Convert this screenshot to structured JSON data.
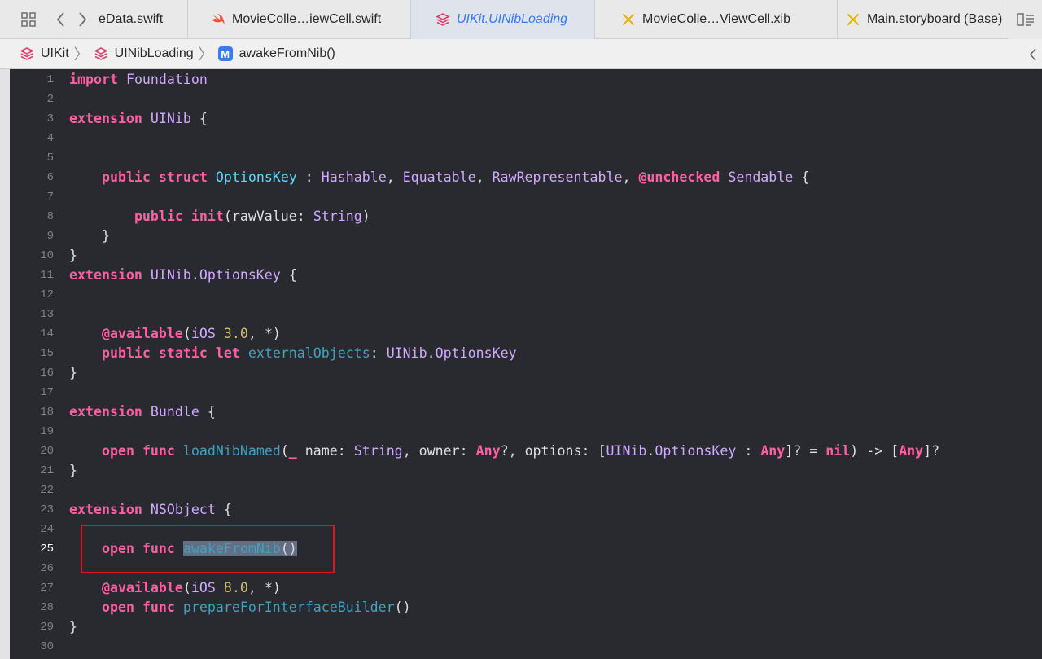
{
  "tabbar": {
    "tabs": [
      {
        "label": "eData.swift",
        "icon": "swift-file-icon"
      },
      {
        "label": "MovieColle…iewCell.swift",
        "icon": "swift-file-icon"
      },
      {
        "label": "UIKit.UINibLoading",
        "icon": "module-stack-icon",
        "active": true
      },
      {
        "label": "MovieColle…ViewCell.xib",
        "icon": "interface-builder-icon"
      },
      {
        "label": "Main.storyboard (Base)",
        "icon": "interface-builder-icon"
      }
    ]
  },
  "jumpbar": {
    "crumbs": [
      "UIKit",
      "UINibLoading",
      "awakeFromNib()"
    ],
    "method_badge": "M"
  },
  "colors": {
    "keyword": "#fc5fa3",
    "type": "#d0a8ff",
    "declaration": "#5dd8ff",
    "function_ref": "#41a1c0",
    "number": "#d0bf69",
    "plain": "#dfdfe0",
    "background": "#292a30",
    "highlight_box": "#e0141e"
  },
  "editor": {
    "current_line": 25,
    "lines": [
      {
        "n": "1",
        "t": [
          [
            "kw",
            "import"
          ],
          [
            "pl",
            " "
          ],
          [
            "ty",
            "Foundation"
          ]
        ]
      },
      {
        "n": "2",
        "t": []
      },
      {
        "n": "3",
        "t": [
          [
            "kw",
            "extension"
          ],
          [
            "pl",
            " "
          ],
          [
            "ty",
            "UINib"
          ],
          [
            "pl",
            " {"
          ]
        ]
      },
      {
        "n": "4",
        "t": []
      },
      {
        "n": "5",
        "t": []
      },
      {
        "n": "6",
        "t": [
          [
            "pl",
            "    "
          ],
          [
            "kw",
            "public"
          ],
          [
            "pl",
            " "
          ],
          [
            "kw",
            "struct"
          ],
          [
            "pl",
            " "
          ],
          [
            "decl",
            "OptionsKey"
          ],
          [
            "pl",
            " : "
          ],
          [
            "ty",
            "Hashable"
          ],
          [
            "pl",
            ", "
          ],
          [
            "ty",
            "Equatable"
          ],
          [
            "pl",
            ", "
          ],
          [
            "ty",
            "RawRepresentable"
          ],
          [
            "pl",
            ", "
          ],
          [
            "kw",
            "@unchecked"
          ],
          [
            "pl",
            " "
          ],
          [
            "ty",
            "Sendable"
          ],
          [
            "pl",
            " {"
          ]
        ]
      },
      {
        "n": "7",
        "t": []
      },
      {
        "n": "8",
        "t": [
          [
            "pl",
            "        "
          ],
          [
            "kw",
            "public"
          ],
          [
            "pl",
            " "
          ],
          [
            "kw",
            "init"
          ],
          [
            "pl",
            "(rawValue: "
          ],
          [
            "ty",
            "String"
          ],
          [
            "pl",
            ")"
          ]
        ]
      },
      {
        "n": "9",
        "t": [
          [
            "pl",
            "    }"
          ]
        ]
      },
      {
        "n": "10",
        "t": [
          [
            "pl",
            "}"
          ]
        ]
      },
      {
        "n": "11",
        "t": [
          [
            "kw",
            "extension"
          ],
          [
            "pl",
            " "
          ],
          [
            "ty",
            "UINib"
          ],
          [
            "pl",
            "."
          ],
          [
            "ty",
            "OptionsKey"
          ],
          [
            "pl",
            " {"
          ]
        ]
      },
      {
        "n": "12",
        "t": []
      },
      {
        "n": "13",
        "t": []
      },
      {
        "n": "14",
        "t": [
          [
            "pl",
            "    "
          ],
          [
            "kw",
            "@available"
          ],
          [
            "pl",
            "("
          ],
          [
            "ty",
            "iOS"
          ],
          [
            "pl",
            " "
          ],
          [
            "num",
            "3.0"
          ],
          [
            "pl",
            ", *)"
          ]
        ]
      },
      {
        "n": "15",
        "t": [
          [
            "pl",
            "    "
          ],
          [
            "kw",
            "public"
          ],
          [
            "pl",
            " "
          ],
          [
            "kw",
            "static"
          ],
          [
            "pl",
            " "
          ],
          [
            "kw",
            "let"
          ],
          [
            "pl",
            " "
          ],
          [
            "fn",
            "externalObjects"
          ],
          [
            "pl",
            ": "
          ],
          [
            "ty",
            "UINib"
          ],
          [
            "pl",
            "."
          ],
          [
            "ty",
            "OptionsKey"
          ]
        ]
      },
      {
        "n": "16",
        "t": [
          [
            "pl",
            "}"
          ]
        ]
      },
      {
        "n": "17",
        "t": []
      },
      {
        "n": "18",
        "t": [
          [
            "kw",
            "extension"
          ],
          [
            "pl",
            " "
          ],
          [
            "ty",
            "Bundle"
          ],
          [
            "pl",
            " {"
          ]
        ]
      },
      {
        "n": "19",
        "t": []
      },
      {
        "n": "20",
        "t": [
          [
            "pl",
            "    "
          ],
          [
            "kw",
            "open"
          ],
          [
            "pl",
            " "
          ],
          [
            "kw",
            "func"
          ],
          [
            "pl",
            " "
          ],
          [
            "fn",
            "loadNibNamed"
          ],
          [
            "pl",
            "("
          ],
          [
            "kw",
            "_"
          ],
          [
            "pl",
            " name: "
          ],
          [
            "ty",
            "String"
          ],
          [
            "pl",
            ", owner: "
          ],
          [
            "kw",
            "Any"
          ],
          [
            "pl",
            "?, options: ["
          ],
          [
            "ty",
            "UINib"
          ],
          [
            "pl",
            "."
          ],
          [
            "ty",
            "OptionsKey"
          ],
          [
            "pl",
            " : "
          ],
          [
            "kw",
            "Any"
          ],
          [
            "pl",
            "]? = "
          ],
          [
            "kw",
            "nil"
          ],
          [
            "pl",
            ") -> ["
          ],
          [
            "kw",
            "Any"
          ],
          [
            "pl",
            "]?"
          ]
        ]
      },
      {
        "n": "21",
        "t": [
          [
            "pl",
            "}"
          ]
        ]
      },
      {
        "n": "22",
        "t": []
      },
      {
        "n": "23",
        "t": [
          [
            "kw",
            "extension"
          ],
          [
            "pl",
            " "
          ],
          [
            "ty",
            "NSObject"
          ],
          [
            "pl",
            " {"
          ]
        ]
      },
      {
        "n": "24",
        "t": []
      },
      {
        "n": "25",
        "t": [
          [
            "pl",
            "    "
          ],
          [
            "kw",
            "open"
          ],
          [
            "pl",
            " "
          ],
          [
            "kw",
            "func"
          ],
          [
            "pl",
            " "
          ],
          [
            "fn sel",
            "awakeFromNib"
          ],
          [
            "pl sel",
            "()"
          ]
        ]
      },
      {
        "n": "26",
        "t": []
      },
      {
        "n": "27",
        "t": [
          [
            "pl",
            "    "
          ],
          [
            "kw",
            "@available"
          ],
          [
            "pl",
            "("
          ],
          [
            "ty",
            "iOS"
          ],
          [
            "pl",
            " "
          ],
          [
            "num",
            "8.0"
          ],
          [
            "pl",
            ", *)"
          ]
        ]
      },
      {
        "n": "28",
        "t": [
          [
            "pl",
            "    "
          ],
          [
            "kw",
            "open"
          ],
          [
            "pl",
            " "
          ],
          [
            "kw",
            "func"
          ],
          [
            "pl",
            " "
          ],
          [
            "fn",
            "prepareForInterfaceBuilder"
          ],
          [
            "pl",
            "()"
          ]
        ]
      },
      {
        "n": "29",
        "t": [
          [
            "pl",
            "}"
          ]
        ]
      },
      {
        "n": "30",
        "t": []
      }
    ]
  }
}
